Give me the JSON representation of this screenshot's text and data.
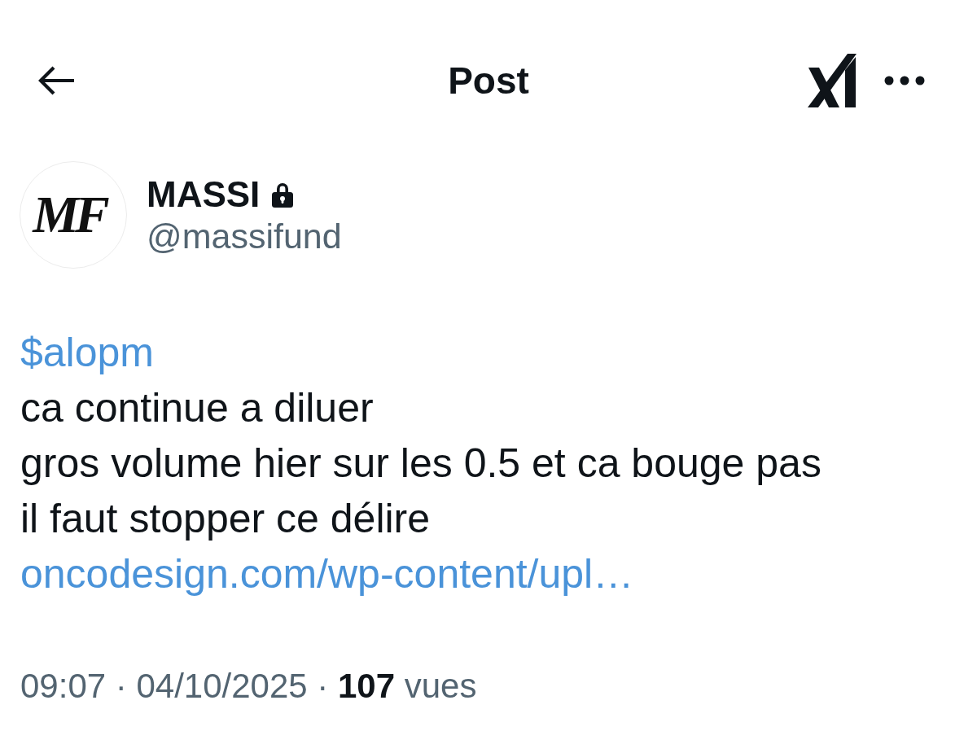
{
  "header": {
    "title": "Post"
  },
  "author": {
    "avatar_monogram": "MF",
    "name": "MASSI",
    "protected": true,
    "handle": "@massifund"
  },
  "body": {
    "lines": [
      {
        "kind": "cashtag",
        "text": "$alopm"
      },
      {
        "kind": "text",
        "text": "ca continue a diluer"
      },
      {
        "kind": "text",
        "text": "gros volume hier sur les 0.5 et ca bouge pas"
      },
      {
        "kind": "text",
        "text": "il faut stopper ce délire"
      },
      {
        "kind": "link",
        "text": "oncodesign.com/wp-content/upl…"
      }
    ]
  },
  "meta": {
    "text": "09:07 · 04/10/2025 · **107** vues"
  }
}
